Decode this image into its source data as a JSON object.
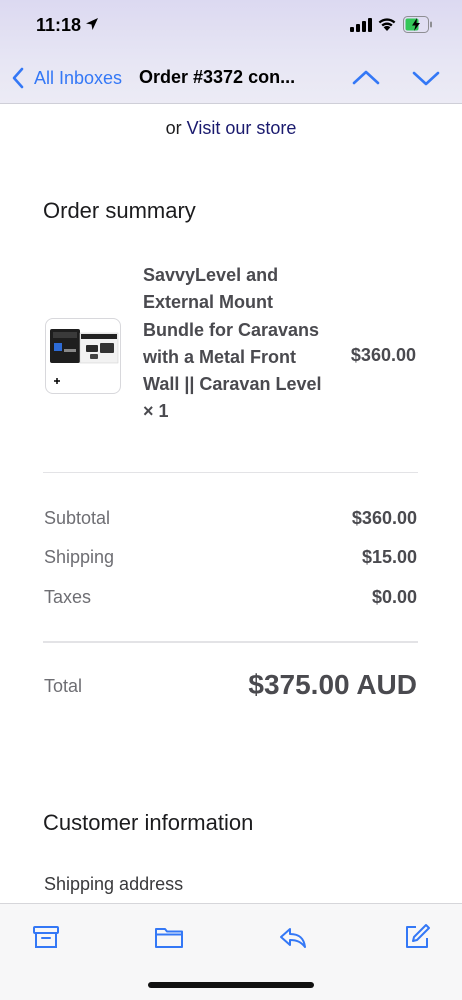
{
  "status_bar": {
    "time": "11:18",
    "icons": [
      "location-arrow-icon",
      "signal-icon",
      "wifi-icon",
      "battery-charging-icon"
    ]
  },
  "nav": {
    "back_label": "All Inboxes",
    "title": "Order #3372 con...",
    "icons": [
      "chevron-left-icon",
      "chevron-up-icon",
      "chevron-down-icon"
    ],
    "accent_color": "#3478f6"
  },
  "email": {
    "store_prefix": "or",
    "store_link": "Visit our store",
    "order_summary_title": "Order summary",
    "product": {
      "name": "SavvyLevel and External Mount Bundle for Caravans with a Metal Front Wall || Caravan Level × 1",
      "price": "$360.00"
    },
    "totals": [
      {
        "label": "Subtotal",
        "value": "$360.00"
      },
      {
        "label": "Shipping",
        "value": "$15.00"
      },
      {
        "label": "Taxes",
        "value": "$0.00"
      }
    ],
    "total_label": "Total",
    "total_value": "$375.00 AUD",
    "customer_info_title": "Customer information",
    "shipping_address_label": "Shipping address"
  },
  "toolbar": {
    "icons": [
      "archive-icon",
      "folder-icon",
      "reply-icon",
      "compose-icon"
    ]
  }
}
